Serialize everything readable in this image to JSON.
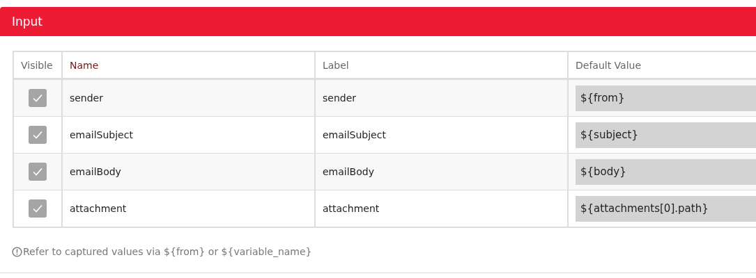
{
  "panel": {
    "title": "Input"
  },
  "table": {
    "columns": [
      {
        "label": "Visible",
        "kind": "plain"
      },
      {
        "label": "Name",
        "kind": "accent"
      },
      {
        "label": "Label",
        "kind": "plain"
      },
      {
        "label": "Default Value",
        "kind": "plain"
      }
    ],
    "rows": [
      {
        "visible": true,
        "name": "sender",
        "label": "sender",
        "default_value": "${from}"
      },
      {
        "visible": true,
        "name": "emailSubject",
        "label": "emailSubject",
        "default_value": "${subject}"
      },
      {
        "visible": true,
        "name": "emailBody",
        "label": "emailBody",
        "default_value": "${body}"
      },
      {
        "visible": true,
        "name": "attachment",
        "label": "attachment",
        "default_value": "${attachments[0].path}"
      }
    ]
  },
  "hint": "Refer to captured values via ${from} or ${variable_name}"
}
